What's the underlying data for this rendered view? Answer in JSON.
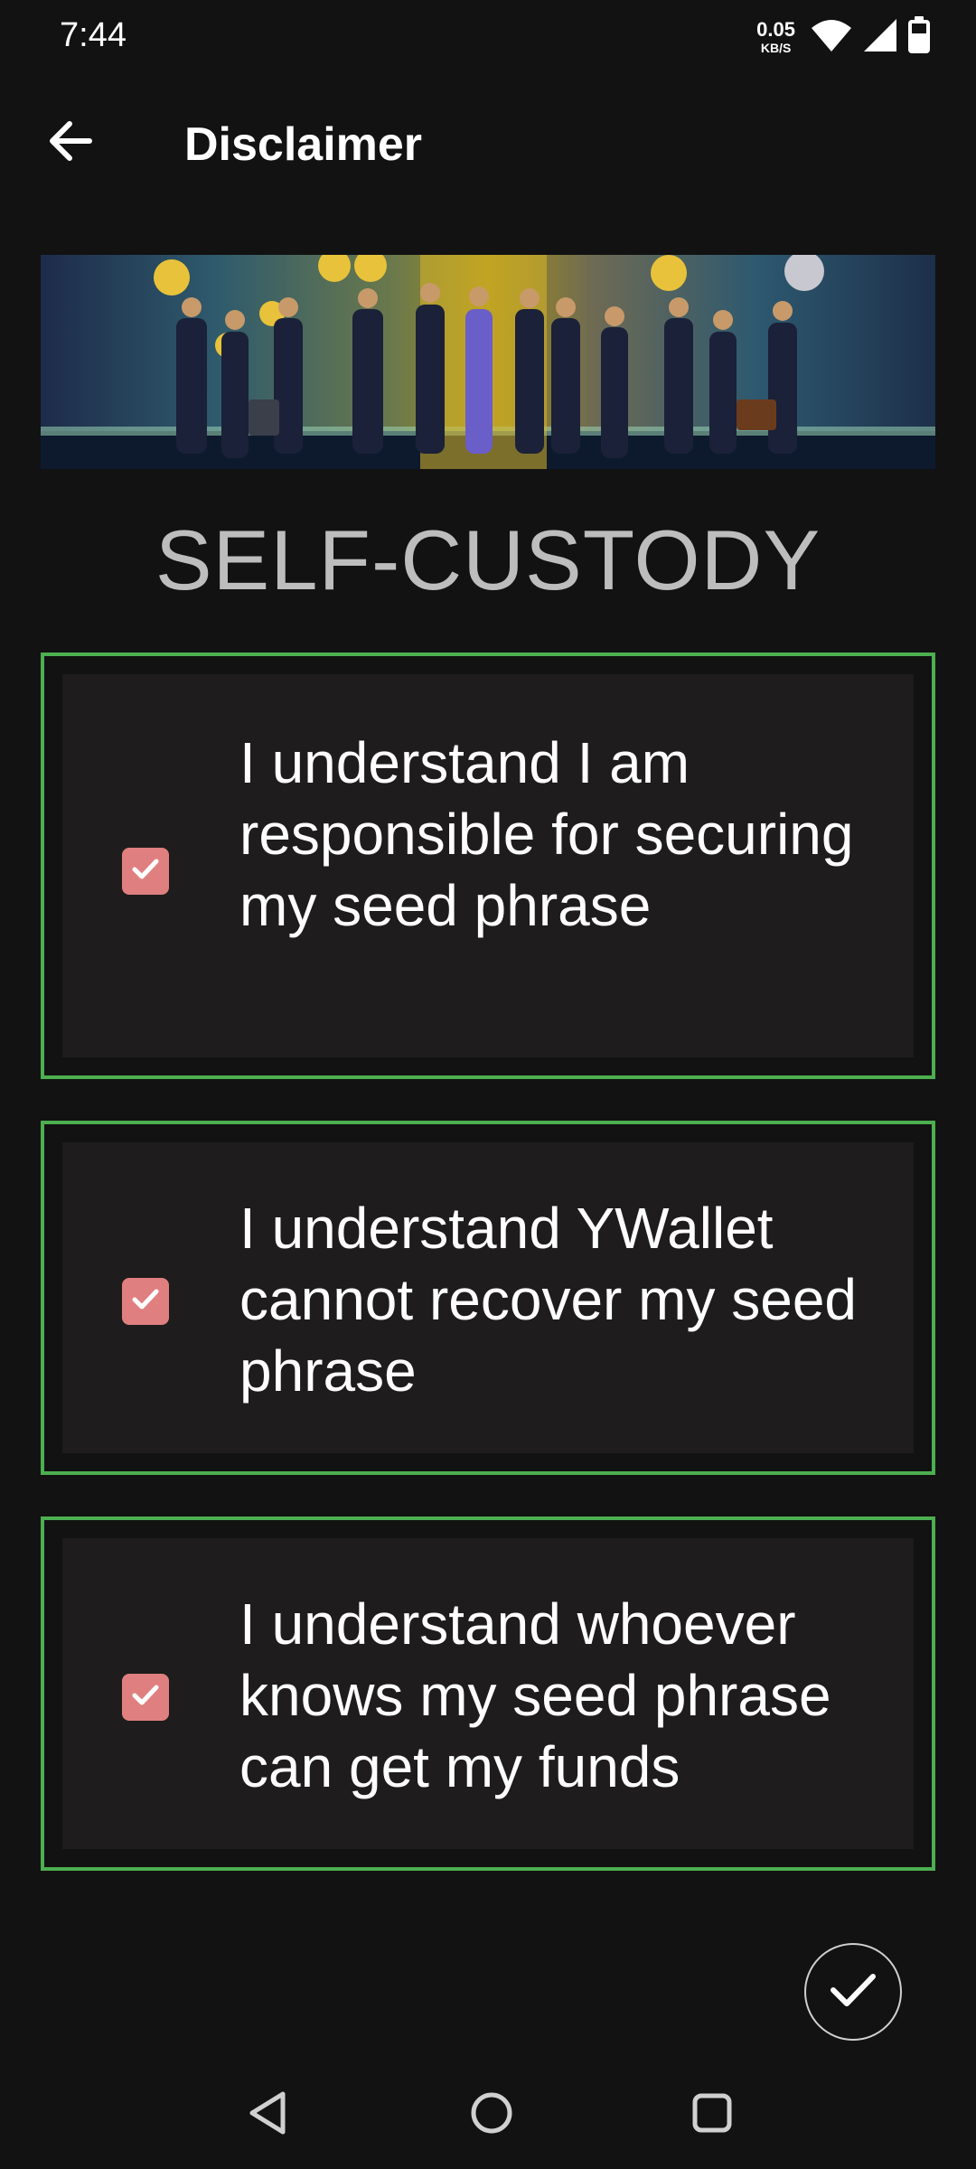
{
  "status_bar": {
    "time": "7:44",
    "net_speed_value": "0.05",
    "net_speed_unit": "KB/S",
    "icons": [
      "wifi-icon",
      "signal-icon",
      "battery-icon"
    ]
  },
  "app_bar": {
    "title": "Disclaimer",
    "back_icon": "arrow-left-icon"
  },
  "banner": {
    "icon": "banner-image"
  },
  "section": {
    "heading": "SELF-CUSTODY"
  },
  "checklist": [
    {
      "text": "I understand I am responsible for securing my seed phrase",
      "checked": true
    },
    {
      "text": "I understand YWallet cannot recover my seed phrase",
      "checked": true
    },
    {
      "text": "I understand whoever knows my seed phrase can get my funds",
      "checked": true
    }
  ],
  "fab": {
    "icon": "check-icon"
  },
  "nav_bar": {
    "icons": [
      "back-triangle-icon",
      "home-circle-icon",
      "recents-square-icon"
    ]
  },
  "colors": {
    "background": "#121212",
    "card_border": "#4caf50",
    "card_fill": "#1e1c1c",
    "checkbox": "#e07f7f",
    "heading": "#bdbdbd"
  }
}
